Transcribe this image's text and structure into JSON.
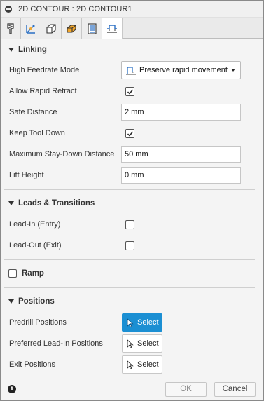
{
  "window": {
    "title": "2D CONTOUR : 2D CONTOUR1"
  },
  "tabs": [
    {
      "name": "tool-tab-icon",
      "active": false
    },
    {
      "name": "geometry-tab-icon",
      "active": false
    },
    {
      "name": "heights-tab-icon",
      "active": false
    },
    {
      "name": "passes-tab-icon",
      "active": false
    },
    {
      "name": "post-tab-icon",
      "active": false
    },
    {
      "name": "linking-tab-icon",
      "active": true
    }
  ],
  "linking": {
    "header": "Linking",
    "high_feedrate_mode": {
      "label": "High Feedrate Mode",
      "value": "Preserve rapid movement"
    },
    "allow_rapid_retract": {
      "label": "Allow Rapid Retract",
      "checked": true
    },
    "safe_distance": {
      "label": "Safe Distance",
      "value": "2 mm"
    },
    "keep_tool_down": {
      "label": "Keep Tool Down",
      "checked": true
    },
    "max_stay_down": {
      "label": "Maximum Stay-Down Distance",
      "value": "50 mm"
    },
    "lift_height": {
      "label": "Lift Height",
      "value": "0 mm"
    }
  },
  "leads": {
    "header": "Leads & Transitions",
    "lead_in": {
      "label": "Lead-In (Entry)",
      "checked": false
    },
    "lead_out": {
      "label": "Lead-Out (Exit)",
      "checked": false
    }
  },
  "ramp": {
    "header": "Ramp",
    "checked": false
  },
  "positions": {
    "header": "Positions",
    "predrill": {
      "label": "Predrill Positions",
      "button": "Select",
      "active": true
    },
    "preferred_lead_in": {
      "label": "Preferred Lead-In Positions",
      "button": "Select",
      "active": false
    },
    "exit": {
      "label": "Exit Positions",
      "button": "Select",
      "active": false
    }
  },
  "footer": {
    "ok_label": "OK",
    "cancel_label": "Cancel"
  },
  "colors": {
    "accent": "#1b8fd3",
    "tab_icon_blue": "#2a6fc4",
    "tab_icon_orange": "#f2a62b"
  }
}
